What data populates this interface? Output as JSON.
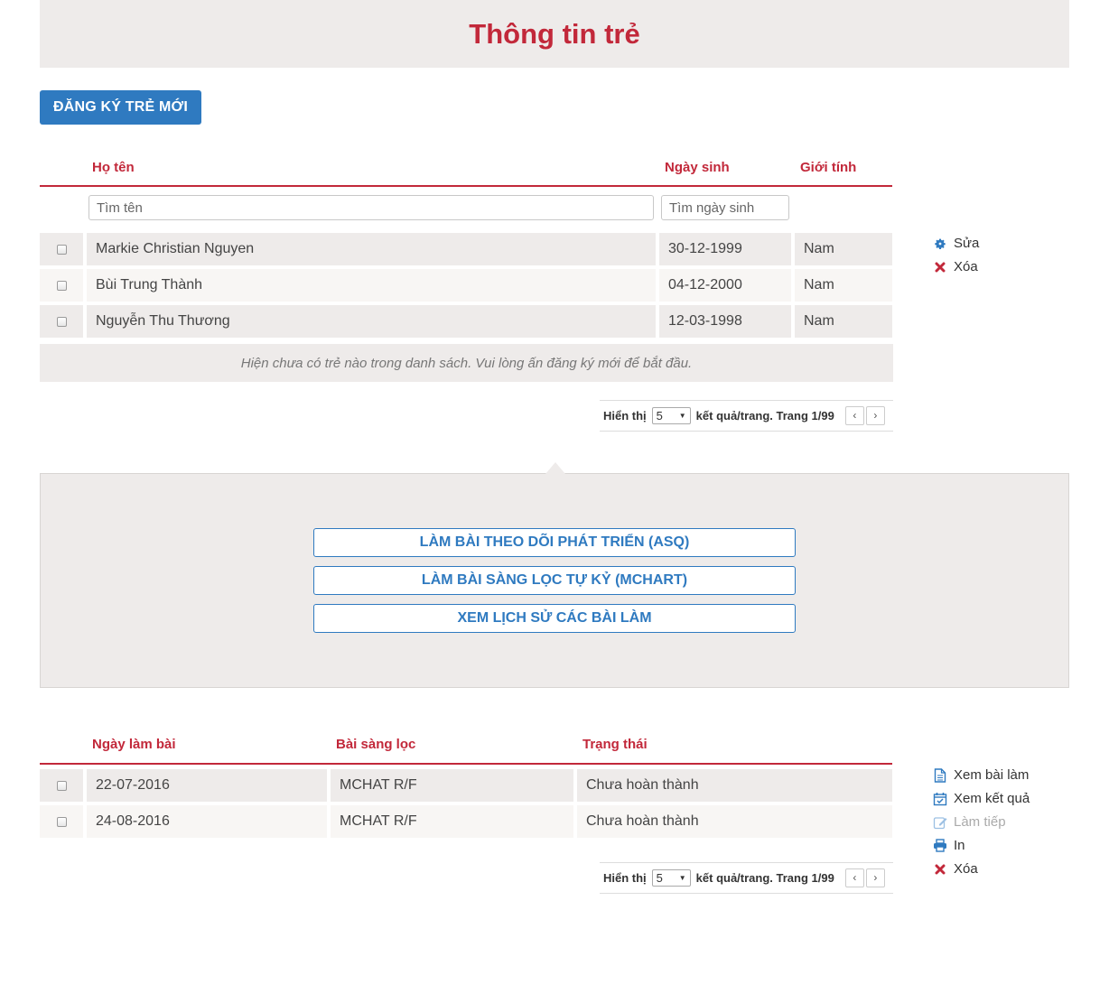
{
  "page": {
    "title": "Thông tin trẻ"
  },
  "register_button": "ĐĂNG KÝ TRẺ MỚI",
  "children_table": {
    "headers": {
      "name": "Họ tên",
      "dob": "Ngày sinh",
      "gender": "Giới tính"
    },
    "search_name_placeholder": "Tìm tên",
    "search_dob_placeholder": "Tìm ngày sinh",
    "rows": [
      {
        "name": "Markie Christian Nguyen",
        "dob": "30-12-1999",
        "gender": "Nam"
      },
      {
        "name": "Bùi Trung Thành",
        "dob": "04-12-2000",
        "gender": "Nam"
      },
      {
        "name": "Nguyễn Thu Thương",
        "dob": "12-03-1998",
        "gender": "Nam"
      }
    ],
    "empty_message": "Hiện chưa có trẻ nào trong danh sách. Vui lòng ấn đăng ký mới để bắt đầu.",
    "pager": {
      "show_label": "Hiển thị",
      "page_size": "5",
      "per_page_text": "kết quả/trang. Trang 1/99",
      "prev": "‹",
      "next": "›"
    },
    "actions": {
      "edit": "Sửa",
      "delete": "Xóa"
    }
  },
  "tests_panel": {
    "asq_button": "LÀM BÀI THEO DÕI PHÁT TRIỂN (ASQ)",
    "mchart_button": "LÀM BÀI SÀNG LỌC TỰ KỶ (MCHART)",
    "history_button": "XEM LỊCH SỬ CÁC BÀI LÀM"
  },
  "history_table": {
    "headers": {
      "date": "Ngày làm bài",
      "test": "Bài sàng lọc",
      "status": "Trạng thái"
    },
    "rows": [
      {
        "date": "22-07-2016",
        "test": "MCHAT R/F",
        "status": "Chưa hoàn thành"
      },
      {
        "date": "24-08-2016",
        "test": "MCHAT R/F",
        "status": "Chưa hoàn thành"
      }
    ],
    "pager": {
      "show_label": "Hiển thị",
      "page_size": "5",
      "per_page_text": "kết quả/trang. Trang 1/99",
      "prev": "‹",
      "next": "›"
    },
    "actions": {
      "view_test": "Xem bài làm",
      "view_result": "Xem kết quả",
      "continue": "Làm tiếp",
      "print": "In",
      "delete": "Xóa"
    }
  },
  "colors": {
    "accent_red": "#c2283a",
    "primary_blue": "#2f7ac0",
    "panel_bg": "#eeebea"
  },
  "icons": {
    "edit": "gear-icon",
    "delete": "x-icon",
    "view_test": "document-icon",
    "view_result": "calendar-check-icon",
    "continue": "pencil-icon",
    "print": "printer-icon"
  }
}
